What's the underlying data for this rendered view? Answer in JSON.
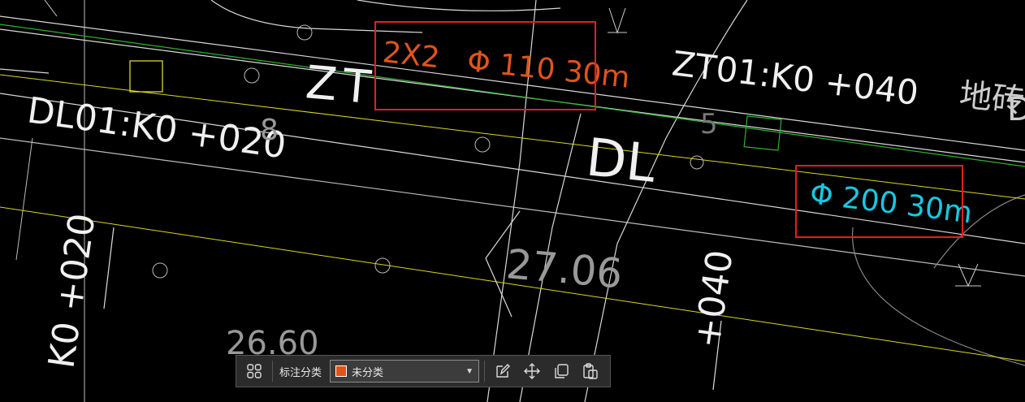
{
  "drawing": {
    "labels": {
      "pipe_spec_1": "2X2   Φ 110 30m",
      "pipe_spec_2": "Φ 200 30m",
      "zt_code": "ZT",
      "zt_station": "ZT01:K0 +040",
      "dl_station": "DL01:K0 +020",
      "dl_code": "DL",
      "elev_1": "27.06",
      "elev_2": "26.60",
      "elev_3": "8",
      "elev_4": "5",
      "chainage_left": "K0 +020",
      "chainage_right": "+040",
      "ground_label": "地砖",
      "edge_letter": "D"
    },
    "colors": {
      "pipe_spec_1": "#e0541a",
      "pipe_spec_2": "#18c8e0",
      "green_line": "#2fb02f",
      "yellow_line": "#d8d820",
      "highlight": "#e02020"
    }
  },
  "toolbar": {
    "grid_icon": "grid-icon",
    "category_label": "标注分类",
    "category_value": "未分类",
    "category_color": "#e0541a",
    "edit_icon": "edit-icon",
    "move_icon": "move-icon",
    "copy_icon": "copy-icon",
    "paste_icon": "paste-icon"
  }
}
